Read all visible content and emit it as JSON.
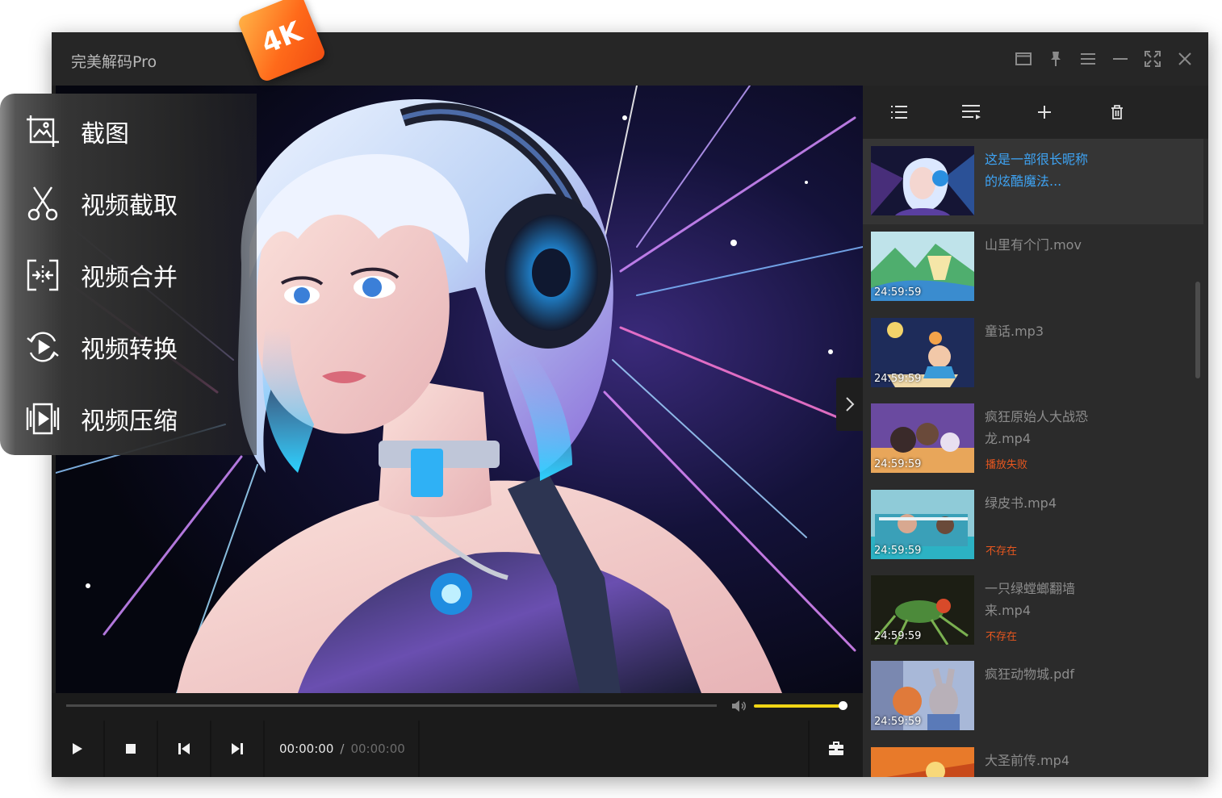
{
  "app": {
    "title": "完美解码Pro",
    "badge": "4K"
  },
  "window_controls": [
    "window-mode-icon",
    "pin-icon",
    "menu-icon",
    "minimize-icon",
    "fullscreen-icon",
    "close-icon"
  ],
  "float_menu": {
    "items": [
      {
        "label": "截图",
        "icon": "screenshot-icon"
      },
      {
        "label": "视频截取",
        "icon": "scissors-icon"
      },
      {
        "label": "视频合并",
        "icon": "merge-icon"
      },
      {
        "label": "视频转换",
        "icon": "convert-icon"
      },
      {
        "label": "视频压缩",
        "icon": "compress-icon"
      }
    ]
  },
  "player": {
    "time_current": "00:00:00",
    "time_separator": "/",
    "time_total": "00:00:00",
    "progress": 0,
    "volume": 1.0,
    "accent_color": "#f1d515"
  },
  "sidebar": {
    "toolbar": [
      "list-icon",
      "sort-icon",
      "add-icon",
      "trash-icon"
    ],
    "playlist": [
      {
        "title": "这是一部很长昵称的炫酷魔法...",
        "duration": "",
        "status": "",
        "active": true
      },
      {
        "title": "山里有个门.mov",
        "duration": "24:59:59",
        "status": ""
      },
      {
        "title": "童话.mp3",
        "duration": "24:59:59",
        "status": ""
      },
      {
        "title": "疯狂原始人大战恐龙.mp4",
        "duration": "24:59:59",
        "status": "播放失败"
      },
      {
        "title": "绿皮书.mp4",
        "duration": "24:59:59",
        "status": "不存在"
      },
      {
        "title": "一只绿螳螂翻墙来.mp4",
        "duration": "24:59:59",
        "status": "不存在"
      },
      {
        "title": "疯狂动物城.pdf",
        "duration": "24:59:59",
        "status": ""
      },
      {
        "title": "大圣前传.mp4",
        "duration": "",
        "status": ""
      }
    ],
    "status_color": "#e8571f",
    "active_color": "#3ea3f3"
  }
}
